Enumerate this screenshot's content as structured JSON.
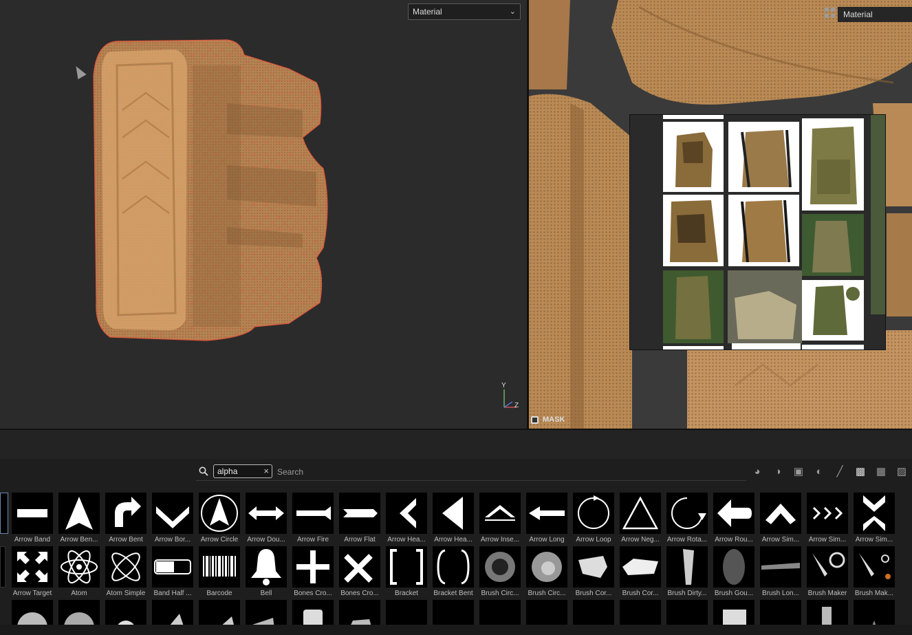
{
  "viewport3d": {
    "material_select": "Material",
    "axis_labels": {
      "y": "Y",
      "z": "Z"
    }
  },
  "viewport2d": {
    "material_label": "Material",
    "mask_label": "MASK"
  },
  "shelf": {
    "search_tag": "alpha",
    "search_placeholder": "Search",
    "filter_icons": [
      "material-icon",
      "smart-material-icon",
      "mask-icon",
      "filter-icon",
      "brush-icon",
      "alpha-icon",
      "texture-icon",
      "environment-icon"
    ],
    "row1": [
      "Arrow Band",
      "Arrow Ben...",
      "Arrow Bent",
      "Arrow Bor...",
      "Arrow Circle",
      "Arrow Dou...",
      "Arrow Fire",
      "Arrow Flat",
      "Arrow Hea...",
      "Arrow Hea...",
      "Arrow Inse...",
      "Arrow Long",
      "Arrow Loop",
      "Arrow Neg...",
      "Arrow Rota...",
      "Arrow Rou...",
      "Arrow Sim...",
      "Arrow Sim...",
      "Arrow Sim..."
    ],
    "row2": [
      "Arrow Target",
      "Atom",
      "Atom Simple",
      "Band Half ...",
      "Barcode",
      "Bell",
      "Bones Cro...",
      "Bones Cro...",
      "Bracket",
      "Bracket Bent",
      "Brush Circ...",
      "Brush Circ...",
      "Brush Cor...",
      "Brush Cor...",
      "Brush Dirty...",
      "Brush Gou...",
      "Brush Lon...",
      "Brush Maker",
      "Brush Mak..."
    ]
  }
}
